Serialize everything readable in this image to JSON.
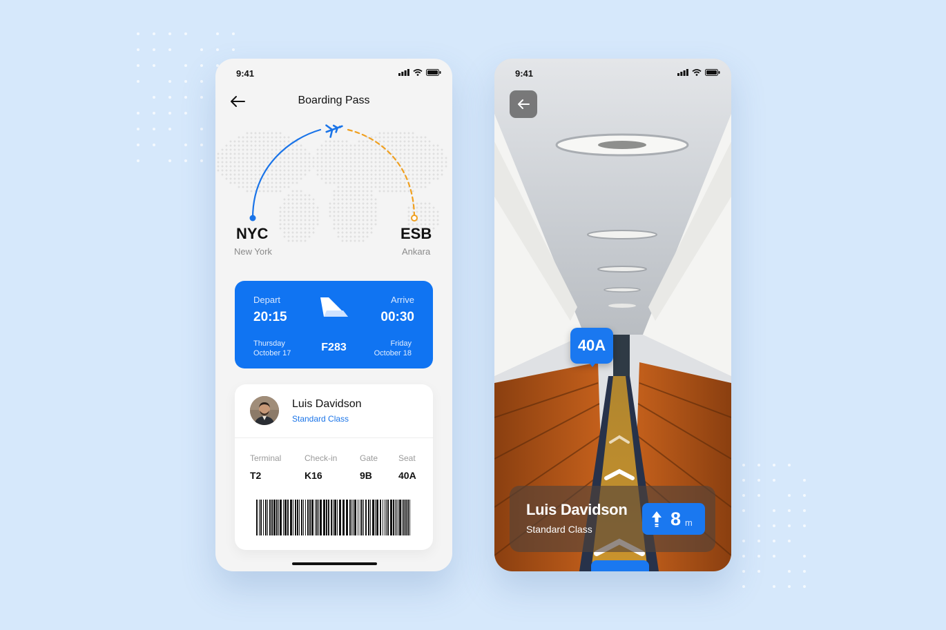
{
  "colors": {
    "background": "#d6e8fb",
    "accent_blue": "#1074f2",
    "route_orange": "#f0a020"
  },
  "left_screen": {
    "status_time": "9:41",
    "status_icons": [
      "signal-icon",
      "wifi-icon",
      "battery-icon"
    ],
    "header": {
      "title": "Boarding Pass",
      "back_icon": "back-arrow-icon"
    },
    "route": {
      "origin": {
        "code": "NYC",
        "city": "New York"
      },
      "destination": {
        "code": "ESB",
        "city": "Ankara"
      },
      "plane_icon": "plane-icon"
    },
    "flight": {
      "depart_label": "Depart",
      "depart_time": "20:15",
      "depart_day": "Thursday",
      "depart_date": "October 17",
      "arrive_label": "Arrive",
      "arrive_time": "00:30",
      "arrive_day": "Friday",
      "arrive_date": "October 18",
      "flight_number": "F283"
    },
    "passenger": {
      "name": "Luis Davidson",
      "class": "Standard Class"
    },
    "details": [
      {
        "label": "Terminal",
        "value": "T2"
      },
      {
        "label": "Check-in",
        "value": "K16"
      },
      {
        "label": "Gate",
        "value": "9B"
      },
      {
        "label": "Seat",
        "value": "40A"
      }
    ]
  },
  "right_screen": {
    "status_time": "9:41",
    "status_icons": [
      "signal-icon",
      "wifi-icon",
      "battery-icon"
    ],
    "back_icon": "back-arrow-icon",
    "seat_marker": "40A",
    "navigation": {
      "name": "Luis Davidson",
      "class": "Standard Class",
      "distance_value": "8",
      "distance_unit": "m",
      "direction_icon": "arrow-up-icon"
    }
  }
}
